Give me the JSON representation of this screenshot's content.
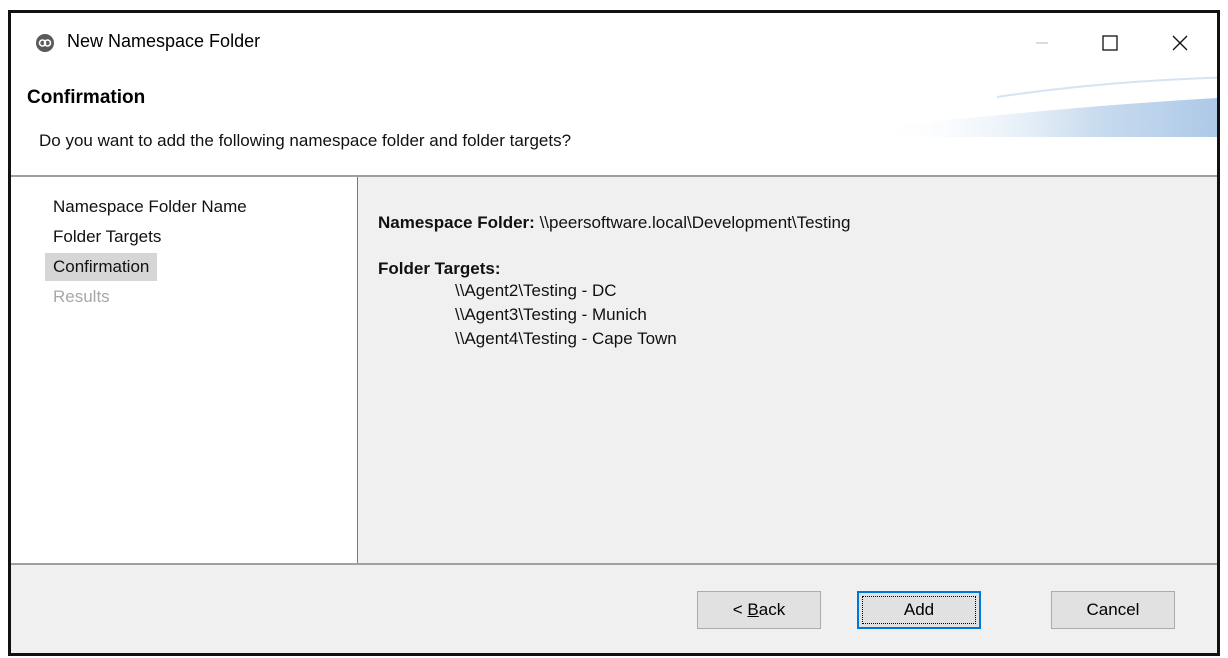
{
  "window": {
    "title": "New Namespace Folder",
    "minimize_glyph": "—",
    "maximize_glyph": "☐",
    "close_glyph": "✕"
  },
  "header": {
    "title": "Confirmation",
    "description": "Do you want to add the following namespace folder and folder targets?"
  },
  "steps": [
    {
      "label": "Namespace Folder Name",
      "state": "normal"
    },
    {
      "label": "Folder Targets",
      "state": "normal"
    },
    {
      "label": "Confirmation",
      "state": "selected"
    },
    {
      "label": "Results",
      "state": "disabled"
    }
  ],
  "summary": {
    "namespace_label": "Namespace Folder:",
    "namespace_value": "\\\\peersoftware.local\\Development\\Testing",
    "targets_label": "Folder Targets:",
    "targets": [
      "\\\\Agent2\\Testing - DC",
      "\\\\Agent3\\Testing - Munich",
      "\\\\Agent4\\Testing - Cape Town"
    ]
  },
  "buttons": {
    "back_prefix": "< ",
    "back_mnemonic": "B",
    "back_rest": "ack",
    "add": "Add",
    "cancel": "Cancel"
  },
  "colors": {
    "default_button_border": "#0078d7",
    "header_swoosh": "#c9dcef"
  }
}
